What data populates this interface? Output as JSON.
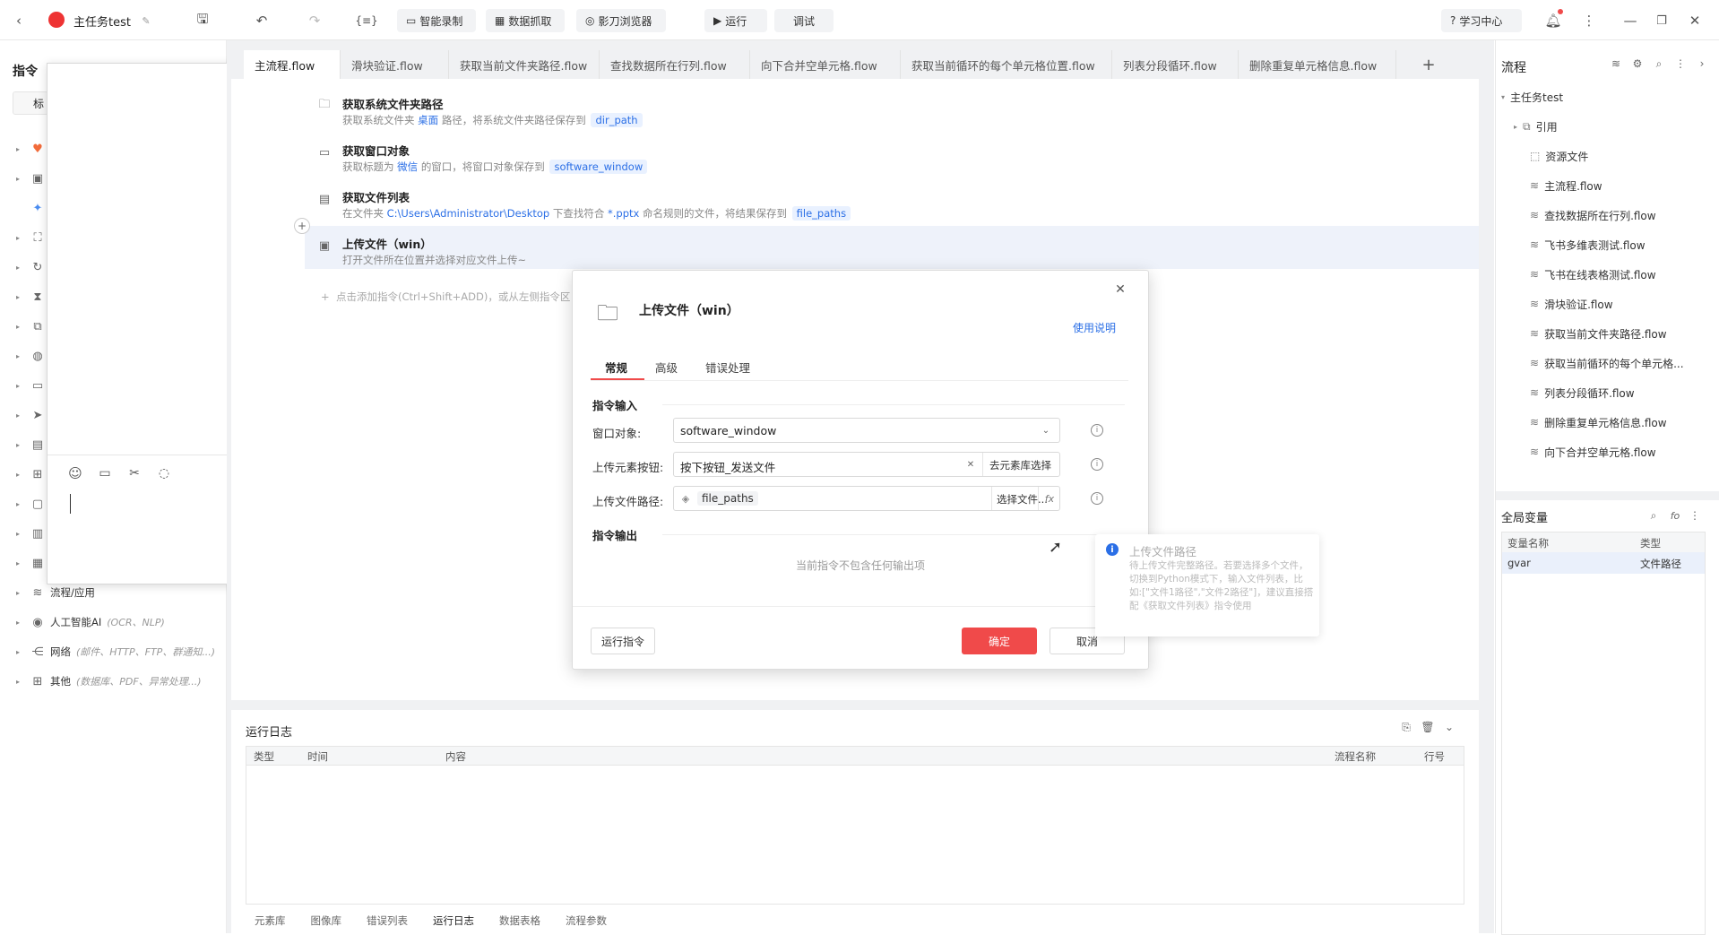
{
  "topbar": {
    "task_name": "主任务test",
    "smart_record": "智能录制",
    "data_capture": "数据抓取",
    "browser": "影刀浏览器",
    "run": "运行",
    "debug": "调试",
    "learning_center": "学习中心"
  },
  "left": {
    "title": "指令",
    "search_tab": "标",
    "partial_category": "流程/应用",
    "categories": [
      {
        "label": "人工智能AI",
        "hint": "(OCR、NLP)"
      },
      {
        "label": "网络",
        "hint": "(邮件、HTTP、FTP、群通知...)"
      },
      {
        "label": "其他",
        "hint": "(数据库、PDF、异常处理...)"
      }
    ]
  },
  "tabs": [
    "主流程.flow",
    "滑块验证.flow",
    "获取当前文件夹路径.flow",
    "查找数据所在行列.flow",
    "向下合并空单元格.flow",
    "获取当前循环的每个单元格位置.flow",
    "列表分段循环.flow",
    "删除重复单元格信息.flow"
  ],
  "steps": [
    {
      "title": "获取系统文件夹路径",
      "d1": "获取系统文件夹",
      "h1": "桌面",
      "d2": "路径，将系统文件夹路径保存到",
      "var": "dir_path"
    },
    {
      "title": "获取窗口对象",
      "d1": "获取标题为",
      "h1": "微信",
      "d2": "的窗口，将窗口对象保存到",
      "var": "software_window"
    },
    {
      "title": "获取文件列表",
      "d1": "在文件夹",
      "h1": "C:\\Users\\Administrator\\Desktop",
      "d2": "下查找符合",
      "h2": "*.pptx",
      "d3": "命名规则的文件，将结果保存到",
      "var": "file_paths"
    },
    {
      "title": "上传文件（win）",
      "d1": "打开文件所在位置并选择对应文件上传~"
    }
  ],
  "add_hint": "点击添加指令(Ctrl+Shift+ADD)，或从左侧指令区",
  "log": {
    "title": "运行日志",
    "columns": [
      "类型",
      "时间",
      "内容",
      "流程名称",
      "行号"
    ],
    "bottom_tabs": [
      "元素库",
      "图像库",
      "错误列表",
      "运行日志",
      "数据表格",
      "流程参数"
    ]
  },
  "right": {
    "title": "流程",
    "root": "主任务test",
    "ref": "引用",
    "resource": "资源文件",
    "flows": [
      "主流程.flow",
      "查找数据所在行列.flow",
      "飞书多维表测试.flow",
      "飞书在线表格测试.flow",
      "滑块验证.flow",
      "获取当前文件夹路径.flow",
      "获取当前循环的每个单元格...",
      "列表分段循环.flow",
      "删除重复单元格信息.flow",
      "向下合并空单元格.flow"
    ],
    "global_vars_title": "全局变量",
    "var_col_name": "变量名称",
    "var_col_type": "类型",
    "var_name": "gvar",
    "var_type": "文件路径"
  },
  "dialog": {
    "title": "上传文件（win）",
    "help": "使用说明",
    "tabs": [
      "常规",
      "高级",
      "错误处理"
    ],
    "input_section": "指令输入",
    "window_label": "窗口对象:",
    "window_value": "software_window",
    "button_label": "上传元素按钮:",
    "button_value": "按下按钮_发送文件",
    "button_pick": "去元素库选择",
    "path_label": "上传文件路径:",
    "path_value": "file_paths",
    "path_pick": "选择文件...",
    "output_section": "指令输出",
    "no_output": "当前指令不包含任何输出项",
    "run_cmd": "运行指令",
    "ok": "确定",
    "cancel": "取消"
  },
  "tooltip": {
    "title": "上传文件路径",
    "body": "待上传文件完整路径。若要选择多个文件，切换到Python模式下，输入文件列表，比如:[\"文件1路径\",\"文件2路径\"]，建议直接搭配《获取文件列表》指令使用"
  },
  "colors": {
    "primary": "#f04a4a",
    "link": "#2b6fe6"
  }
}
